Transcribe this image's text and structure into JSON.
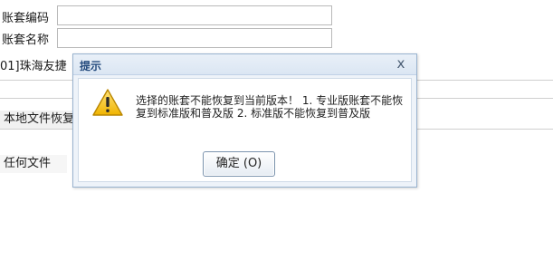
{
  "form": {
    "account_code_label": "账套编码",
    "account_name_label": "账套名称",
    "account_selected": "01]珠海友捷",
    "local_restore_label": "本地文件恢复",
    "any_file_label": "任何文件"
  },
  "dialog": {
    "title": "提示",
    "close_glyph": "x",
    "message": "选择的账套不能恢复到当前版本！ 1. 专业版账套不能恢复到标准版和普及版 2. 标准版不能恢复到普及版",
    "ok_label": "确定 (O)",
    "icon": "warning-icon",
    "accent_color": "#234a7d"
  }
}
